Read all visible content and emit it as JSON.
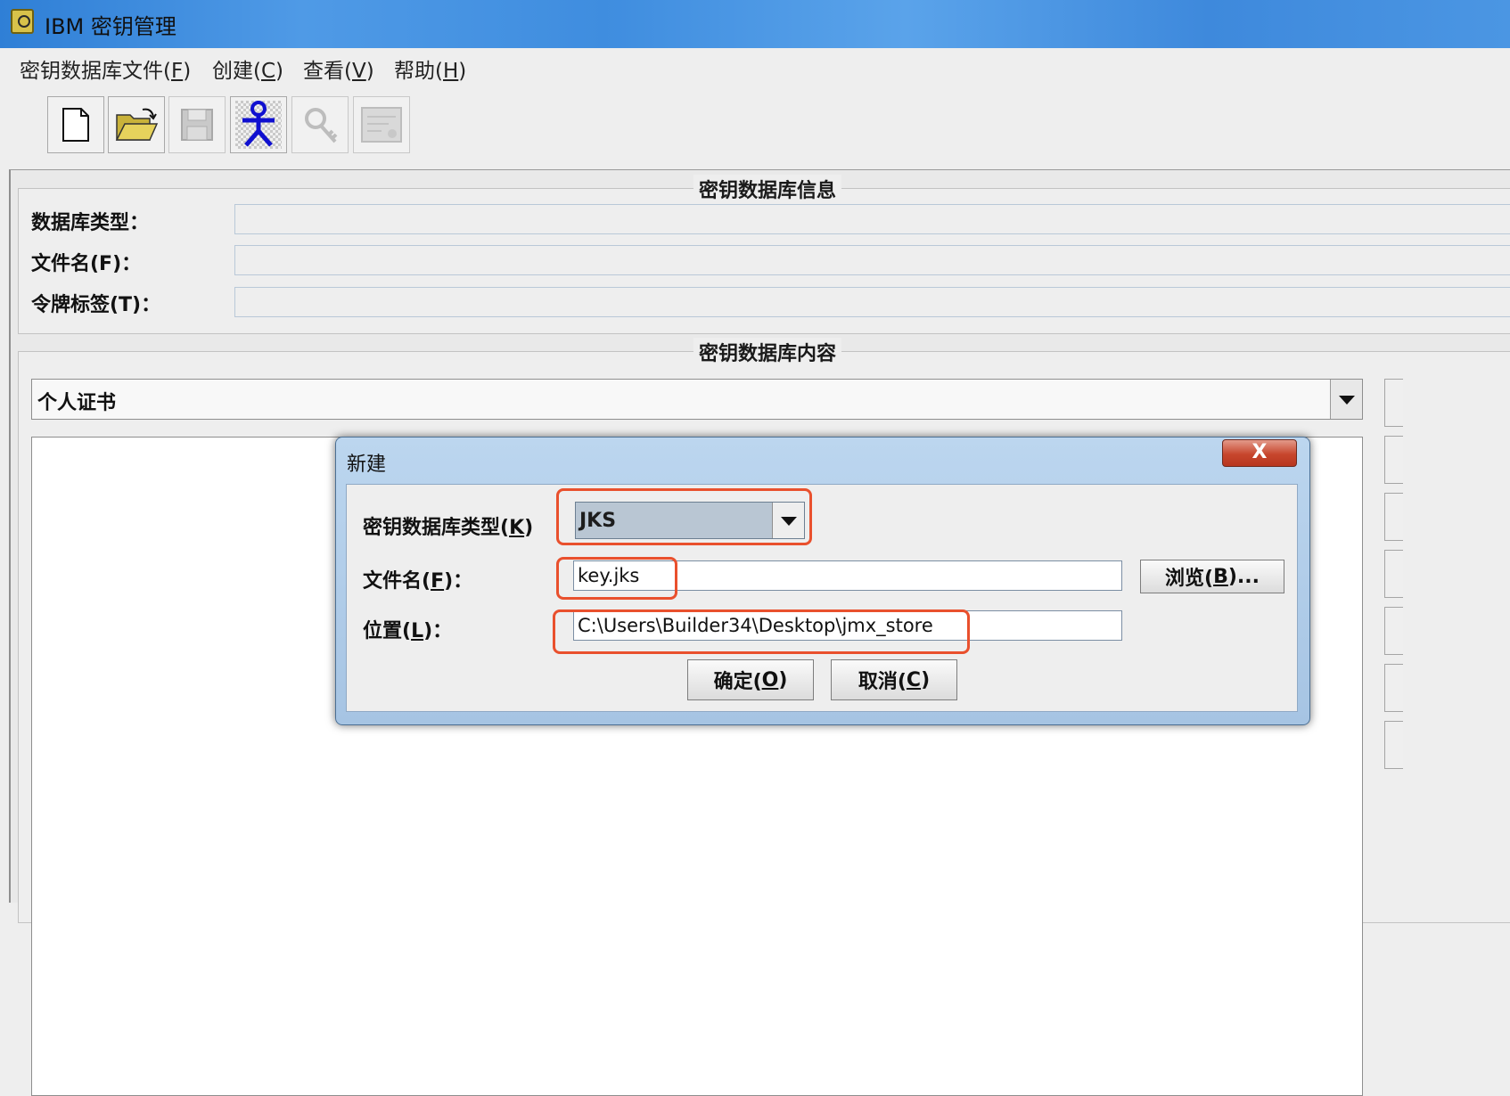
{
  "window": {
    "title": "IBM 密钥管理"
  },
  "menu": [
    {
      "label": "密钥数据库文件(",
      "key": "F",
      "end": ")"
    },
    {
      "label": "创建(",
      "key": "C",
      "end": ")"
    },
    {
      "label": "查看(",
      "key": "V",
      "end": ")"
    },
    {
      "label": "帮助(",
      "key": "H",
      "end": ")"
    }
  ],
  "toolbar": {
    "icons": [
      "new-file-icon",
      "open-folder-icon",
      "save-icon",
      "person-icon",
      "key-icon",
      "certificate-icon"
    ]
  },
  "info_group": {
    "title": "密钥数据库信息",
    "labels": [
      "数据库类型：",
      "文件名(F)：",
      "令牌标签(T)："
    ]
  },
  "content_group": {
    "title": "密钥数据库内容",
    "selected": "个人证书"
  },
  "dialog": {
    "title": "新建",
    "close": "X",
    "type_label": {
      "text": "密钥数据库类型(",
      "key": "K",
      "end": ")"
    },
    "type_value": "JKS",
    "file_label": {
      "text": "文件名(",
      "key": "F",
      "end": ")："
    },
    "file_value": "key.jks",
    "location_label": {
      "text": "位置(",
      "key": "L",
      "end": ")："
    },
    "location_value": "C:\\Users\\Builder34\\Desktop\\jmx_store",
    "browse": {
      "text": "浏览(",
      "key": "B",
      "end": ")..."
    },
    "ok": {
      "text": "确定(",
      "key": "O",
      "end": ")"
    },
    "cancel": {
      "text": "取消(",
      "key": "C",
      "end": ")"
    }
  },
  "colors": {
    "highlight": "#e9502d",
    "titlebar": "#3f8ddf"
  }
}
